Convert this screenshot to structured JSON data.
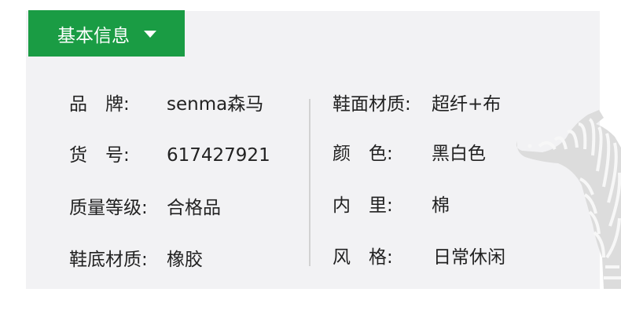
{
  "tab": {
    "label": "基本信息",
    "icon": "caret-down-icon",
    "color": "#1a9c44"
  },
  "left_column": [
    {
      "label": "品　牌:",
      "value": "senma森马"
    },
    {
      "label": "货　号:",
      "value": "617427921"
    },
    {
      "label": "质量等级:",
      "value": "合格品"
    },
    {
      "label": "鞋底材质:",
      "value": "橡胶"
    }
  ],
  "right_column": [
    {
      "label": "鞋面材质:",
      "value": "超纤+布"
    },
    {
      "label": "颜　色:",
      "value": "黑白色"
    },
    {
      "label": "内　里:",
      "value": "棉"
    },
    {
      "label": "风　格:",
      "value": "日常休闲"
    }
  ],
  "decoration": {
    "icon": "zebra-watermark-icon"
  }
}
